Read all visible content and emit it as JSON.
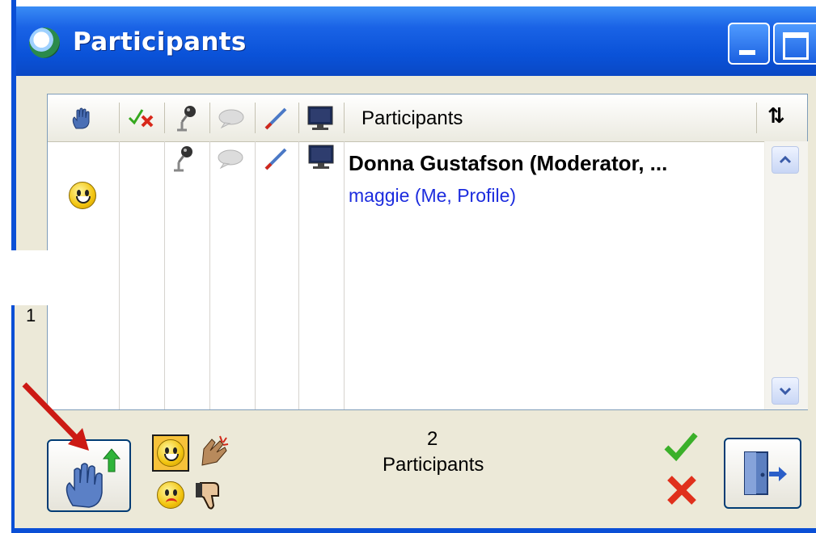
{
  "window": {
    "title": "Participants",
    "app_icon": "participants-app-icon",
    "controls": [
      "minimize-icon",
      "maximize-icon"
    ]
  },
  "list": {
    "header": {
      "columns": [
        {
          "icon": "raise-hand-icon"
        },
        {
          "icon": "agree-disagree-icon"
        },
        {
          "icon": "microphone-icon"
        },
        {
          "icon": "chat-bubble-icon"
        },
        {
          "icon": "pencil-icon"
        },
        {
          "icon": "screen-share-icon"
        }
      ],
      "participants_label": "Participants",
      "sort_icon": "⇅"
    },
    "rows": [
      {
        "name": "Donna Gustafson (Moderator, ...",
        "status_icons": [
          "microphone-icon",
          "chat-bubble-icon",
          "pencil-icon",
          "screen-share-icon"
        ]
      },
      {
        "name": "maggie (Me, Profile)",
        "status_icons": [
          "smiley-icon"
        ]
      }
    ]
  },
  "stray_text": "1",
  "footer": {
    "count": "2",
    "count_label": "Participants",
    "raise_hand_button": "raise-hand-up-icon",
    "feedback_icons": [
      "smiley-icon",
      "applause-icon",
      "confused-icon",
      "thumbs-down-icon"
    ],
    "agree_icon": "checkmark-icon",
    "disagree_icon": "red-x-icon",
    "exit_button": "exit-door-icon",
    "annotation_arrow": "red-arrow-icon"
  },
  "colors": {
    "title_bar": "#0a52d8",
    "client_bg": "#ece9d8",
    "me_name": "#1c2cde"
  }
}
